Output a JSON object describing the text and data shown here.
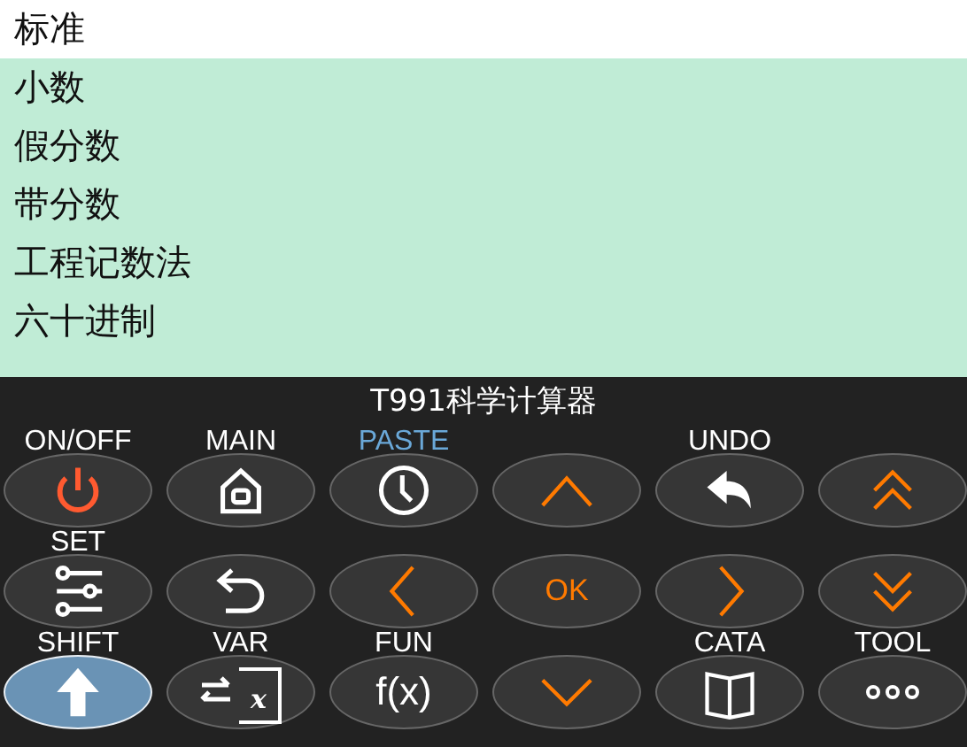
{
  "menu": {
    "items": [
      {
        "label": "标准",
        "selected": true
      },
      {
        "label": "小数",
        "selected": false
      },
      {
        "label": "假分数",
        "selected": false
      },
      {
        "label": "带分数",
        "selected": false
      },
      {
        "label": "工程记数法",
        "selected": false
      },
      {
        "label": "六十进制",
        "selected": false
      }
    ]
  },
  "keypad": {
    "title": "T991科学计算器",
    "keys": [
      {
        "label": "ON/OFF",
        "label_highlighted": false,
        "kind": "power",
        "selected": false
      },
      {
        "label": "MAIN",
        "label_highlighted": false,
        "kind": "home",
        "selected": false
      },
      {
        "label": "PASTE",
        "label_highlighted": true,
        "kind": "clock",
        "selected": false
      },
      {
        "kind": "up",
        "selected": false
      },
      {
        "label": "UNDO",
        "label_highlighted": false,
        "kind": "undo",
        "selected": false
      },
      {
        "kind": "double-up",
        "selected": false
      },
      {
        "label": "SET",
        "label_highlighted": false,
        "kind": "sliders",
        "selected": false
      },
      {
        "kind": "return",
        "selected": false
      },
      {
        "kind": "left",
        "selected": false
      },
      {
        "kind": "text",
        "text": "OK",
        "selected": false
      },
      {
        "kind": "right",
        "selected": false
      },
      {
        "kind": "double-down",
        "selected": false
      },
      {
        "label": "SHIFT",
        "label_highlighted": false,
        "kind": "shift",
        "selected": true
      },
      {
        "label": "VAR",
        "label_highlighted": false,
        "kind": "variable",
        "text": "x",
        "selected": false
      },
      {
        "label": "FUN",
        "label_highlighted": false,
        "kind": "function",
        "text": "f(x)",
        "selected": false
      },
      {
        "kind": "down",
        "selected": false
      },
      {
        "label": "CATA",
        "label_highlighted": false,
        "kind": "book",
        "selected": false
      },
      {
        "label": "TOOL",
        "label_highlighted": false,
        "kind": "dots",
        "selected": false
      }
    ]
  }
}
